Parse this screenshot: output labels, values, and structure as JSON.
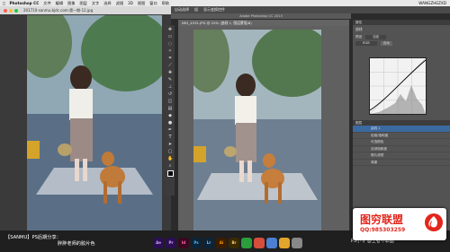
{
  "menubar": {
    "app": "Photoshop CC",
    "items": [
      "文件",
      "编辑",
      "图像",
      "图层",
      "文字",
      "选择",
      "滤镜",
      "3D",
      "视图",
      "窗口",
      "帮助"
    ],
    "user": "WANGZHEZXD"
  },
  "left_window": {
    "title": "201710-sanmu.bjdc.com-第一期-12.jpg"
  },
  "photoshop": {
    "window_title": "Adobe Photoshop CC 2015",
    "doc_tab": "IMG_4331.JPG @ 25% (曲线 1, 图层蒙版/8)",
    "toolbar_items": [
      "自动选择",
      "组",
      "显示变换控件"
    ]
  },
  "panels": {
    "header": "属性",
    "curves_label": "曲线",
    "preset_label": "预设",
    "preset_value": "自定",
    "channel_value": "RGB",
    "auto_label": "自动",
    "layers_header": "图层",
    "layer_rows": [
      "曲线 1",
      "色相/饱和度",
      "可选颜色",
      "自然饱和度",
      "照片滤镜",
      "背景"
    ]
  },
  "caption": {
    "line1": "【SANMU】PS后期分享：",
    "line2": "胖胖老师的胶片色"
  },
  "dock_apps": [
    {
      "label": "Ae",
      "color": "#2a0f52"
    },
    {
      "label": "Pr",
      "color": "#2a0f52"
    },
    {
      "label": "Id",
      "color": "#3a0722"
    },
    {
      "label": "Ps",
      "color": "#0b2438"
    },
    {
      "label": "Lr",
      "color": "#0b2438"
    },
    {
      "label": "Ai",
      "color": "#3a1d00"
    },
    {
      "label": "Br",
      "color": "#3a2a00"
    }
  ],
  "credit": "PS小专 @王者不靠图",
  "logo": {
    "title": "图穷联盟",
    "qq": "QQ:985303259",
    "colors": {
      "brand": "#e2261c"
    }
  }
}
